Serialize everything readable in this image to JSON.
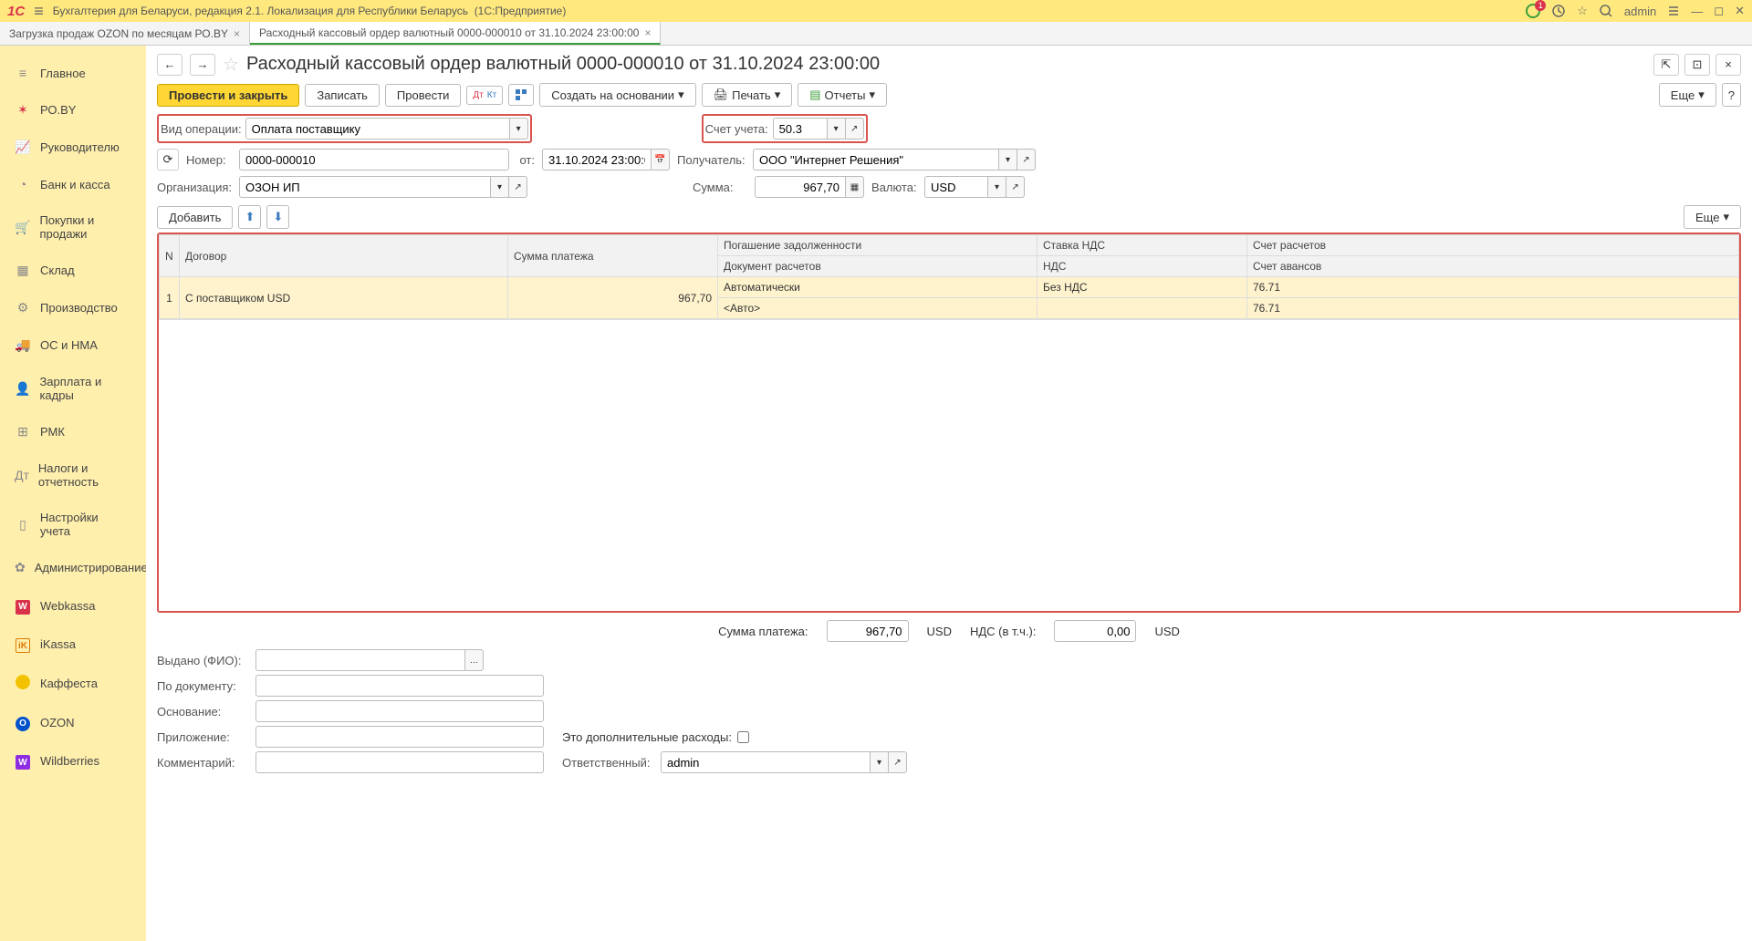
{
  "titlebar": {
    "app_title": "Бухгалтерия для Беларуси, редакция 2.1. Локализация для Республики Беларусь",
    "platform": "(1С:Предприятие)",
    "user": "admin",
    "badge": "1"
  },
  "tabs": [
    {
      "label": "Загрузка продаж OZON по месяцам РО.BY",
      "active": false
    },
    {
      "label": "Расходный кассовый ордер валютный 0000-000010 от 31.10.2024 23:00:00",
      "active": true
    }
  ],
  "sidebar": [
    {
      "label": "Главное"
    },
    {
      "label": "РО.BY"
    },
    {
      "label": "Руководителю"
    },
    {
      "label": "Банк и касса"
    },
    {
      "label": "Покупки и продажи"
    },
    {
      "label": "Склад"
    },
    {
      "label": "Производство"
    },
    {
      "label": "ОС и НМА"
    },
    {
      "label": "Зарплата и кадры"
    },
    {
      "label": "РМК"
    },
    {
      "label": "Налоги и отчетность"
    },
    {
      "label": "Настройки учета"
    },
    {
      "label": "Администрирование"
    },
    {
      "label": "Webkassa"
    },
    {
      "label": "iKassa"
    },
    {
      "label": "Каффеста"
    },
    {
      "label": "OZON"
    },
    {
      "label": "Wildberries"
    }
  ],
  "doc": {
    "title": "Расходный кассовый ордер валютный 0000-000010 от 31.10.2024 23:00:00"
  },
  "toolbar": {
    "post_close": "Провести и закрыть",
    "write": "Записать",
    "post": "Провести",
    "create_based": "Создать на основании",
    "print": "Печать",
    "reports": "Отчеты",
    "more": "Еще",
    "help": "?"
  },
  "form": {
    "operation_type_label": "Вид операции:",
    "operation_type_value": "Оплата поставщику",
    "account_label": "Счет учета:",
    "account_value": "50.3",
    "number_label": "Номер:",
    "number_value": "0000-000010",
    "date_label": "от:",
    "date_value": "31.10.2024 23:00:00",
    "recipient_label": "Получатель:",
    "recipient_value": "ООО \"Интернет Решения\"",
    "org_label": "Организация:",
    "org_value": "ОЗОН ИП",
    "sum_label": "Сумма:",
    "sum_value": "967,70",
    "currency_label": "Валюта:",
    "currency_value": "USD"
  },
  "table": {
    "add": "Добавить",
    "more": "Еще",
    "headers": {
      "n": "N",
      "contract": "Договор",
      "payment_sum": "Сумма платежа",
      "debt_repay": "Погашение задолженности",
      "settlement_doc": "Документ расчетов",
      "vat_rate": "Ставка НДС",
      "vat": "НДС",
      "settlement_acc": "Счет расчетов",
      "advance_acc": "Счет авансов"
    },
    "row": {
      "n": "1",
      "contract": "С поставщиком USD",
      "payment_sum": "967,70",
      "debt_repay": "Автоматически",
      "settlement_doc": "<Авто>",
      "vat_rate": "Без НДС",
      "settlement_acc": "76.71",
      "advance_acc": "76.71"
    }
  },
  "totals": {
    "payment_sum_label": "Сумма платежа:",
    "payment_sum_value": "967,70",
    "payment_sum_cur": "USD",
    "vat_label": "НДС (в т.ч.):",
    "vat_value": "0,00",
    "vat_cur": "USD"
  },
  "bottom": {
    "issued_label": "Выдано (ФИО):",
    "doc_label": "По документу:",
    "basis_label": "Основание:",
    "attachment_label": "Приложение:",
    "extra_costs_label": "Это дополнительные расходы:",
    "comment_label": "Комментарий:",
    "responsible_label": "Ответственный:",
    "responsible_value": "admin"
  }
}
